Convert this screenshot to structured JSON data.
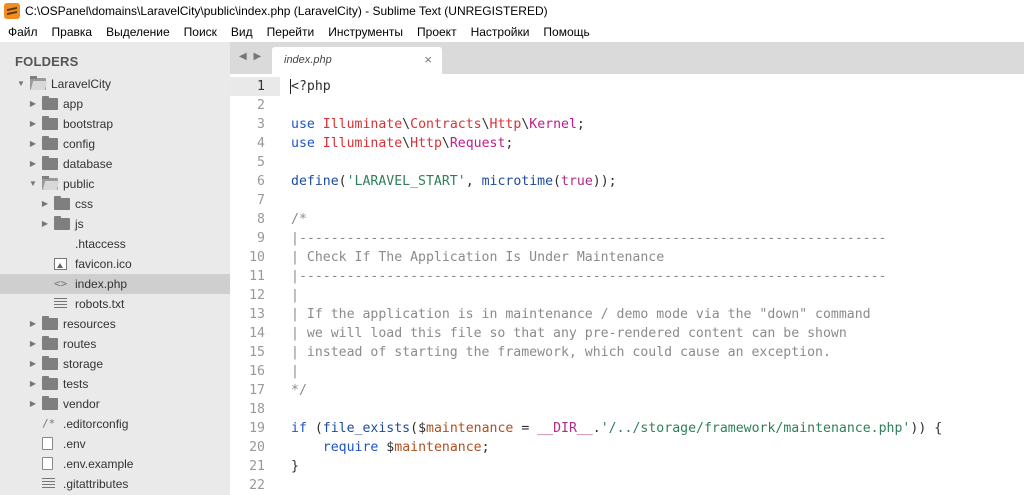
{
  "window": {
    "title": "C:\\OSPanel\\domains\\LaravelCity\\public\\index.php (LaravelCity) - Sublime Text (UNREGISTERED)"
  },
  "menu": [
    "Файл",
    "Правка",
    "Выделение",
    "Поиск",
    "Вид",
    "Перейти",
    "Инструменты",
    "Проект",
    "Настройки",
    "Помощь"
  ],
  "sidebar": {
    "header": "FOLDERS",
    "items": [
      {
        "label": "LaravelCity",
        "kind": "folder",
        "depth": 0,
        "expanded": true
      },
      {
        "label": "app",
        "kind": "folder",
        "depth": 1,
        "expanded": false
      },
      {
        "label": "bootstrap",
        "kind": "folder",
        "depth": 1,
        "expanded": false
      },
      {
        "label": "config",
        "kind": "folder",
        "depth": 1,
        "expanded": false
      },
      {
        "label": "database",
        "kind": "folder",
        "depth": 1,
        "expanded": false
      },
      {
        "label": "public",
        "kind": "folder",
        "depth": 1,
        "expanded": true
      },
      {
        "label": "css",
        "kind": "folder",
        "depth": 2,
        "expanded": false
      },
      {
        "label": "js",
        "kind": "folder",
        "depth": 2,
        "expanded": false
      },
      {
        "label": ".htaccess",
        "kind": "file",
        "depth": 2
      },
      {
        "label": "favicon.ico",
        "kind": "image",
        "depth": 2
      },
      {
        "label": "index.php",
        "kind": "code",
        "depth": 2,
        "selected": true
      },
      {
        "label": "robots.txt",
        "kind": "lines",
        "depth": 2
      },
      {
        "label": "resources",
        "kind": "folder",
        "depth": 1,
        "expanded": false
      },
      {
        "label": "routes",
        "kind": "folder",
        "depth": 1,
        "expanded": false
      },
      {
        "label": "storage",
        "kind": "folder",
        "depth": 1,
        "expanded": false
      },
      {
        "label": "tests",
        "kind": "folder",
        "depth": 1,
        "expanded": false
      },
      {
        "label": "vendor",
        "kind": "folder",
        "depth": 1,
        "expanded": false
      },
      {
        "label": ".editorconfig",
        "kind": "comment",
        "depth": 1
      },
      {
        "label": ".env",
        "kind": "file",
        "depth": 1
      },
      {
        "label": ".env.example",
        "kind": "file",
        "depth": 1
      },
      {
        "label": ".gitattributes",
        "kind": "lines",
        "depth": 1
      }
    ]
  },
  "tabs": {
    "arrows": "◀ ▶",
    "active": {
      "label": "index.php",
      "close": "×"
    }
  },
  "editor": {
    "current_line": 1,
    "lines": [
      {
        "n": "1",
        "tokens": [
          [
            "default",
            "<?php"
          ]
        ]
      },
      {
        "n": "2",
        "tokens": []
      },
      {
        "n": "3",
        "tokens": [
          [
            "keyword",
            "use "
          ],
          [
            "class",
            "Illuminate"
          ],
          [
            "default",
            "\\"
          ],
          [
            "class",
            "Contracts"
          ],
          [
            "default",
            "\\"
          ],
          [
            "class",
            "Http"
          ],
          [
            "default",
            "\\"
          ],
          [
            "class2",
            "Kernel"
          ],
          [
            "default",
            ";"
          ]
        ]
      },
      {
        "n": "4",
        "tokens": [
          [
            "keyword",
            "use "
          ],
          [
            "class",
            "Illuminate"
          ],
          [
            "default",
            "\\"
          ],
          [
            "class",
            "Http"
          ],
          [
            "default",
            "\\"
          ],
          [
            "class2",
            "Request"
          ],
          [
            "default",
            ";"
          ]
        ]
      },
      {
        "n": "5",
        "tokens": []
      },
      {
        "n": "6",
        "tokens": [
          [
            "func",
            "define"
          ],
          [
            "default",
            "("
          ],
          [
            "string",
            "'LARAVEL_START'"
          ],
          [
            "default",
            ", "
          ],
          [
            "func",
            "microtime"
          ],
          [
            "default",
            "("
          ],
          [
            "const",
            "true"
          ],
          [
            "default",
            "));"
          ]
        ]
      },
      {
        "n": "7",
        "tokens": []
      },
      {
        "n": "8",
        "tokens": [
          [
            "comment",
            "/*"
          ]
        ]
      },
      {
        "n": "9",
        "tokens": [
          [
            "comment",
            "|--------------------------------------------------------------------------"
          ]
        ]
      },
      {
        "n": "10",
        "tokens": [
          [
            "comment",
            "| Check If The Application Is Under Maintenance"
          ]
        ]
      },
      {
        "n": "11",
        "tokens": [
          [
            "comment",
            "|--------------------------------------------------------------------------"
          ]
        ]
      },
      {
        "n": "12",
        "tokens": [
          [
            "comment",
            "|"
          ]
        ]
      },
      {
        "n": "13",
        "tokens": [
          [
            "comment",
            "| If the application is in maintenance / demo mode via the \"down\" command"
          ]
        ]
      },
      {
        "n": "14",
        "tokens": [
          [
            "comment",
            "| we will load this file so that any pre-rendered content can be shown"
          ]
        ]
      },
      {
        "n": "15",
        "tokens": [
          [
            "comment",
            "| instead of starting the framework, which could cause an exception."
          ]
        ]
      },
      {
        "n": "16",
        "tokens": [
          [
            "comment",
            "|"
          ]
        ]
      },
      {
        "n": "17",
        "tokens": [
          [
            "comment",
            "*/"
          ]
        ]
      },
      {
        "n": "18",
        "tokens": []
      },
      {
        "n": "19",
        "tokens": [
          [
            "keyword",
            "if "
          ],
          [
            "default",
            "("
          ],
          [
            "func",
            "file_exists"
          ],
          [
            "default",
            "("
          ],
          [
            "default",
            "$"
          ],
          [
            "var",
            "maintenance"
          ],
          [
            "default",
            " = "
          ],
          [
            "const",
            "__DIR__"
          ],
          [
            "default",
            "."
          ],
          [
            "string",
            "'/../storage/framework/maintenance.php'"
          ],
          [
            "default",
            ")) {"
          ]
        ]
      },
      {
        "n": "20",
        "tokens": [
          [
            "default",
            "    "
          ],
          [
            "keyword",
            "require "
          ],
          [
            "default",
            "$"
          ],
          [
            "var",
            "maintenance"
          ],
          [
            "default",
            ";"
          ]
        ]
      },
      {
        "n": "21",
        "tokens": [
          [
            "default",
            "}"
          ]
        ]
      },
      {
        "n": "22",
        "tokens": []
      }
    ]
  }
}
